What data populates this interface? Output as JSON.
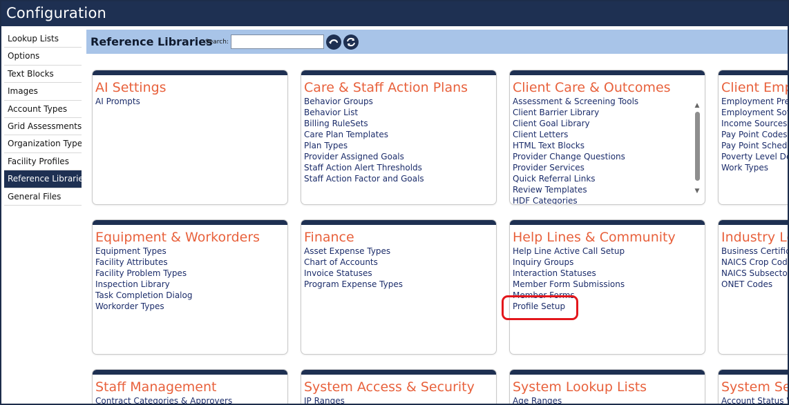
{
  "window": {
    "title": "Configuration"
  },
  "sidebar": {
    "items": [
      {
        "label": "Lookup Lists"
      },
      {
        "label": "Options"
      },
      {
        "label": "Text Blocks"
      },
      {
        "label": "Images"
      },
      {
        "label": "Account Types"
      },
      {
        "label": "Grid Assessments"
      },
      {
        "label": "Organization Types"
      },
      {
        "label": "Facility Profiles"
      },
      {
        "label": "Reference Libraries",
        "active": true
      },
      {
        "label": "General Files"
      }
    ]
  },
  "header": {
    "title": "Reference Libraries",
    "search_label": "Search:",
    "search_value": "",
    "icons": [
      "back-icon",
      "refresh-icon"
    ]
  },
  "colors": {
    "navy": "#1e3052",
    "header_blue": "#a8c4e8",
    "card_title": "#e8613c",
    "link": "#1b2c6a",
    "highlight": "#e3161b"
  },
  "cards": [
    {
      "title": "AI Settings",
      "items": [
        "AI Prompts"
      ]
    },
    {
      "title": "Care & Staff Action Plans",
      "items": [
        "Behavior Groups",
        "Behavior List",
        "Billing RuleSets",
        "Care Plan Templates",
        "Plan Types",
        "Provider Assigned Goals",
        "Staff Action Alert Thresholds",
        "Staff Action Factor and Goals"
      ]
    },
    {
      "title": "Client Care & Outcomes",
      "items": [
        "Assessment & Screening Tools",
        "Client Barrier Library",
        "Client Goal Library",
        "Client Letters",
        "HTML Text Blocks",
        "Provider Change Questions",
        "Provider Services",
        "Quick Referral Links",
        "Review Templates",
        "HDF Categories"
      ]
    },
    {
      "title": "Client Employment",
      "items": [
        "Employment Prework",
        "Employment Soft Skills",
        "Income Sources",
        "Pay Point Codes",
        "Pay Point Schedules",
        "Poverty Level Definitions",
        "Work Types"
      ]
    },
    {
      "title": "Equipment & Workorders",
      "items": [
        "Equipment Types",
        "Facility Attributes",
        "Facility Problem Types",
        "Inspection Library",
        "Task Completion Dialog",
        "Workorder Types"
      ]
    },
    {
      "title": "Finance",
      "items": [
        "Asset Expense Types",
        "Chart of Accounts",
        "Invoice Statuses",
        "Program Expense Types"
      ]
    },
    {
      "title": "Help Lines & Community",
      "items": [
        "Help Line Active Call Setup",
        "Inquiry Groups",
        "Interaction Statuses",
        "Member Form Submissions",
        "Member Forms",
        "Profile Setup"
      ]
    },
    {
      "title": "Industry Lookups",
      "items": [
        "Business Certifications",
        "NAICS Crop Codes",
        "NAICS Subsectors",
        "ONET Codes"
      ]
    },
    {
      "title": "Staff Management",
      "items": [
        "Contract Categories & Approvers"
      ]
    },
    {
      "title": "System Access & Security",
      "items": [
        "IP Ranges"
      ]
    },
    {
      "title": "System Lookup Lists",
      "items": [
        "Age Ranges"
      ]
    },
    {
      "title": "System Settings",
      "items": [
        "Account Status Wizard"
      ]
    }
  ]
}
